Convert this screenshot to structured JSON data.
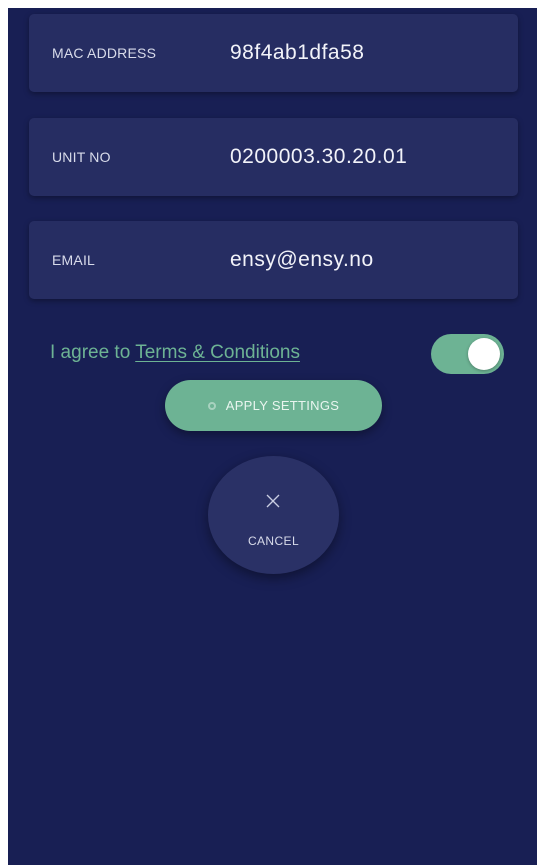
{
  "fields": [
    {
      "label": "MAC ADDRESS",
      "value": "98f4ab1dfa58"
    },
    {
      "label": "UNIT NO",
      "value": "0200003.30.20.01"
    },
    {
      "label": "EMAIL",
      "value": "ensy@ensy.no"
    }
  ],
  "agreement": {
    "prefix": "I agree to ",
    "link_text": "Terms & Conditions",
    "toggle_on": true
  },
  "actions": {
    "apply_label": "APPLY SETTINGS",
    "cancel_label": "CANCEL",
    "cancel_icon": "close-icon"
  },
  "colors": {
    "background": "#181f54",
    "card": "#262d62",
    "accent": "#6db394"
  }
}
